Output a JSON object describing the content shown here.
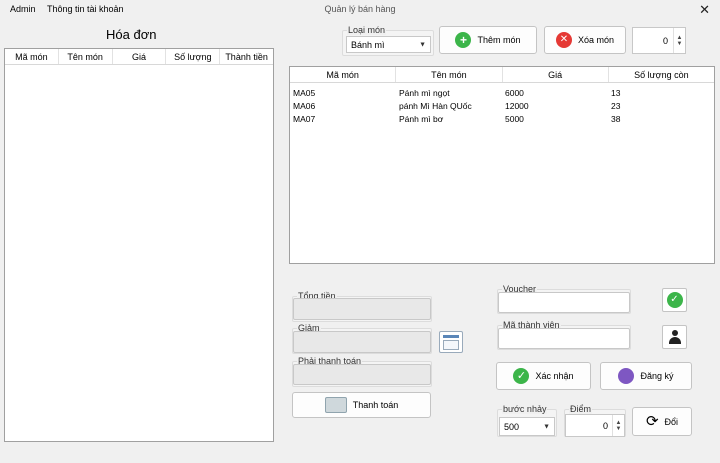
{
  "menu": {
    "admin": "Admin",
    "account": "Thông tin tài khoản"
  },
  "window": {
    "title": "Quản lý bán hàng",
    "close": "✕"
  },
  "invoice": {
    "title": "Hóa đơn",
    "columns": [
      "Mã món",
      "Tên món",
      "Giá",
      "Số lượng",
      "Thành tiền"
    ]
  },
  "category": {
    "legend": "Loại món",
    "value": "Bánh mì"
  },
  "buttons": {
    "add": "Thêm món",
    "remove": "Xóa món",
    "confirm": "Xác nhận",
    "register": "Đăng ký",
    "pay": "Thanh toán",
    "exchange": "Đổi"
  },
  "quantity": {
    "value": "0"
  },
  "menu_table": {
    "columns": [
      "Mã món",
      "Tên món",
      "Giá",
      "Số lượng còn"
    ],
    "rows": [
      [
        "MA05",
        "Pánh mì ngọt",
        "6000",
        "13"
      ],
      [
        "MA06",
        "pánh Mì Hàn QUốc",
        "12000",
        "23"
      ],
      [
        "MA07",
        "Pánh mì bơ",
        "5000",
        "38"
      ]
    ]
  },
  "totals": {
    "total_label": "Tổng tiền",
    "discount_label": "Giảm",
    "payable_label": "Phải thanh toán"
  },
  "voucher": {
    "label": "Voucher"
  },
  "member": {
    "label": "Mã thành viên"
  },
  "step": {
    "label": "bước nhảy",
    "value": "500"
  },
  "points": {
    "label": "Điểm",
    "value": "0"
  },
  "colors": {
    "green": "#3cb54a",
    "red": "#e53935",
    "border": "#a0a0a0"
  }
}
